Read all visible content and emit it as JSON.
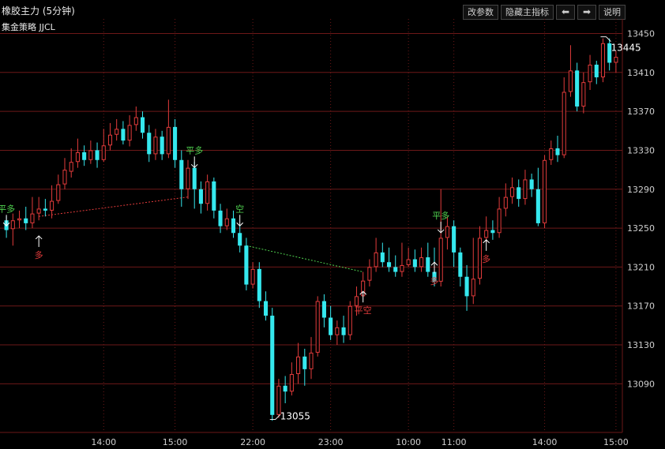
{
  "header": {
    "title": "橡胶主力 (5分钟)",
    "strategy": "集金策略  JJCL"
  },
  "toolbar": {
    "params": "改参数",
    "hide_indicator": "隐藏主指标",
    "left_arrow": "⬅",
    "right_arrow": "➡",
    "help": "说明"
  },
  "colors": {
    "up": "#e23b3b",
    "down": "#35e8ee",
    "grid": "#6d1818",
    "axis_text": "#cfcfcf",
    "buy_signal": "#e23b3b",
    "sell_signal": "#4fd14f",
    "trade_line_red": "#e23b3b",
    "trade_line_green": "#4fd14f"
  },
  "chart_data": {
    "type": "candlestick",
    "ylim": [
      13040,
      13465
    ],
    "y_ticks": [
      13450,
      13410,
      13370,
      13330,
      13290,
      13250,
      13210,
      13170,
      13130,
      13090
    ],
    "x_ticks": [
      {
        "label": "14:00",
        "index": 15
      },
      {
        "label": "15:00",
        "index": 26
      },
      {
        "label": "22:00",
        "index": 38
      },
      {
        "label": "23:00",
        "index": 50
      },
      {
        "label": "10:00",
        "index": 62
      },
      {
        "label": "11:00",
        "index": 69
      },
      {
        "label": "14:00",
        "index": 83
      },
      {
        "label": "15:00",
        "index": 94
      }
    ],
    "candles": [
      [
        13258,
        13248,
        13262,
        13240
      ],
      [
        13249,
        13258,
        13265,
        13232
      ],
      [
        13258,
        13260,
        13268,
        13250
      ],
      [
        13260,
        13255,
        13272,
        13248
      ],
      [
        13255,
        13265,
        13282,
        13250
      ],
      [
        13265,
        13270,
        13282,
        13258
      ],
      [
        13270,
        13268,
        13280,
        13262
      ],
      [
        13268,
        13278,
        13294,
        13260
      ],
      [
        13278,
        13295,
        13305,
        13275
      ],
      [
        13295,
        13310,
        13322,
        13290
      ],
      [
        13308,
        13318,
        13332,
        13302
      ],
      [
        13318,
        13328,
        13342,
        13312
      ],
      [
        13328,
        13320,
        13335,
        13314
      ],
      [
        13320,
        13330,
        13340,
        13316
      ],
      [
        13330,
        13320,
        13338,
        13312
      ],
      [
        13320,
        13335,
        13352,
        13318
      ],
      [
        13335,
        13346,
        13358,
        13330
      ],
      [
        13346,
        13352,
        13362,
        13340
      ],
      [
        13352,
        13340,
        13360,
        13336
      ],
      [
        13340,
        13356,
        13366,
        13334
      ],
      [
        13356,
        13364,
        13375,
        13350
      ],
      [
        13364,
        13348,
        13370,
        13342
      ],
      [
        13348,
        13326,
        13356,
        13318
      ],
      [
        13326,
        13344,
        13352,
        13320
      ],
      [
        13344,
        13326,
        13350,
        13320
      ],
      [
        13326,
        13354,
        13382,
        13322
      ],
      [
        13354,
        13320,
        13362,
        13312
      ],
      [
        13320,
        13290,
        13330,
        13272
      ],
      [
        13290,
        13312,
        13320,
        13280
      ],
      [
        13312,
        13290,
        13318,
        13270
      ],
      [
        13290,
        13275,
        13298,
        13265
      ],
      [
        13275,
        13298,
        13305,
        13268
      ],
      [
        13298,
        13268,
        13302,
        13260
      ],
      [
        13268,
        13252,
        13275,
        13245
      ],
      [
        13252,
        13260,
        13270,
        13248
      ],
      [
        13260,
        13245,
        13268,
        13240
      ],
      [
        13245,
        13232,
        13252,
        13225
      ],
      [
        13232,
        13192,
        13240,
        13186
      ],
      [
        13192,
        13208,
        13215,
        13188
      ],
      [
        13208,
        13175,
        13215,
        13168
      ],
      [
        13175,
        13160,
        13185,
        13155
      ],
      [
        13160,
        13058,
        13168,
        13052
      ],
      [
        13058,
        13088,
        13095,
        13055
      ],
      [
        13088,
        13082,
        13098,
        13070
      ],
      [
        13082,
        13100,
        13112,
        13078
      ],
      [
        13100,
        13118,
        13132,
        13090
      ],
      [
        13118,
        13105,
        13126,
        13088
      ],
      [
        13105,
        13122,
        13138,
        13095
      ],
      [
        13122,
        13175,
        13180,
        13118
      ],
      [
        13175,
        13158,
        13182,
        13148
      ],
      [
        13158,
        13140,
        13170,
        13135
      ],
      [
        13140,
        13148,
        13155,
        13130
      ],
      [
        13148,
        13140,
        13160,
        13132
      ],
      [
        13140,
        13170,
        13175,
        13135
      ],
      [
        13170,
        13180,
        13190,
        13160
      ],
      [
        13180,
        13196,
        13205,
        13190
      ],
      [
        13196,
        13210,
        13218,
        13190
      ],
      [
        13210,
        13225,
        13240,
        13205
      ],
      [
        13225,
        13215,
        13235,
        13210
      ],
      [
        13215,
        13210,
        13230,
        13205
      ],
      [
        13210,
        13205,
        13222,
        13200
      ],
      [
        13205,
        13212,
        13235,
        13200
      ],
      [
        13212,
        13218,
        13230,
        13210
      ],
      [
        13218,
        13210,
        13228,
        13205
      ],
      [
        13210,
        13220,
        13230,
        13205
      ],
      [
        13220,
        13205,
        13235,
        13200
      ],
      [
        13205,
        13195,
        13230,
        13190
      ],
      [
        13195,
        13240,
        13290,
        13190
      ],
      [
        13240,
        13252,
        13262,
        13228
      ],
      [
        13252,
        13225,
        13258,
        13210
      ],
      [
        13225,
        13200,
        13230,
        13190
      ],
      [
        13200,
        13180,
        13212,
        13165
      ],
      [
        13180,
        13198,
        13240,
        13172
      ],
      [
        13198,
        13240,
        13252,
        13192
      ],
      [
        13240,
        13248,
        13262,
        13235
      ],
      [
        13248,
        13245,
        13258,
        13238
      ],
      [
        13245,
        13270,
        13282,
        13240
      ],
      [
        13270,
        13282,
        13296,
        13262
      ],
      [
        13282,
        13292,
        13302,
        13275
      ],
      [
        13292,
        13280,
        13300,
        13272
      ],
      [
        13280,
        13300,
        13310,
        13274
      ],
      [
        13300,
        13290,
        13306,
        13282
      ],
      [
        13290,
        13255,
        13312,
        13252
      ],
      [
        13255,
        13320,
        13325,
        13250
      ],
      [
        13320,
        13332,
        13340,
        13315
      ],
      [
        13332,
        13325,
        13345,
        13318
      ],
      [
        13325,
        13390,
        13405,
        13322
      ],
      [
        13390,
        13412,
        13438,
        13385
      ],
      [
        13412,
        13375,
        13420,
        13370
      ],
      [
        13375,
        13400,
        13410,
        13368
      ],
      [
        13400,
        13418,
        13428,
        13392
      ],
      [
        13418,
        13405,
        13422,
        13398
      ],
      [
        13405,
        13440,
        13445,
        13400
      ],
      [
        13440,
        13420,
        13445,
        13412
      ],
      [
        13420,
        13426,
        13432,
        13410
      ]
    ],
    "annotations": {
      "high": {
        "label": "13445",
        "index": 92,
        "price": 13445
      },
      "low": {
        "label": "13055",
        "index": 41,
        "price": 13055
      }
    },
    "signals": [
      {
        "index": 0,
        "price": 13262,
        "dir": "down",
        "label": "平多"
      },
      {
        "index": 5,
        "price": 13242,
        "dir": "up",
        "label": "多"
      },
      {
        "index": 29,
        "price": 13322,
        "dir": "down",
        "label": "平多"
      },
      {
        "index": 36,
        "price": 13262,
        "dir": "down",
        "label": "空"
      },
      {
        "index": 55,
        "price": 13185,
        "dir": "up",
        "label": "平空"
      },
      {
        "index": 67,
        "price": 13255,
        "dir": "down",
        "label": "平多"
      },
      {
        "index": 66,
        "price": 13215,
        "dir": "up",
        "label": "多"
      },
      {
        "index": 74,
        "price": 13238,
        "dir": "up",
        "label": "多"
      }
    ],
    "trade_lines": [
      {
        "from": [
          5,
          13262
        ],
        "to": [
          28,
          13282
        ],
        "color": "red"
      },
      {
        "from": [
          37,
          13232
        ],
        "to": [
          55,
          13205
        ],
        "color": "green"
      }
    ]
  }
}
